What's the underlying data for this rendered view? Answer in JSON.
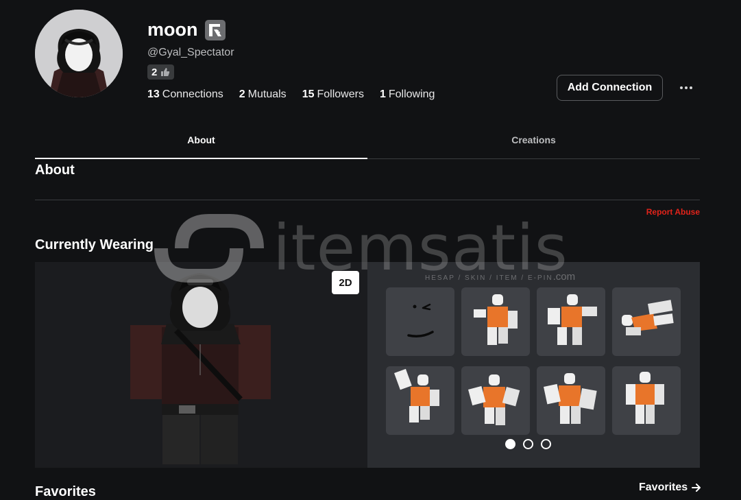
{
  "profile": {
    "display_name": "moon",
    "username": "@Gyal_Spectator",
    "badge_count": "2",
    "premium_icon": "premium-r-icon",
    "stats": [
      {
        "value": "13",
        "label": "Connections"
      },
      {
        "value": "2",
        "label": "Mutuals"
      },
      {
        "value": "15",
        "label": "Followers"
      },
      {
        "value": "1",
        "label": "Following"
      }
    ],
    "add_connection_label": "Add Connection"
  },
  "tabs": [
    {
      "label": "About",
      "active": true
    },
    {
      "label": "Creations",
      "active": false
    }
  ],
  "about": {
    "title": "About",
    "report_label": "Report Abuse"
  },
  "currently_wearing": {
    "title": "Currently Wearing",
    "toggle_label": "2D",
    "items": [
      {
        "kind": "face",
        "icon": "wink-face-icon"
      },
      {
        "kind": "animation",
        "icon": "avatar-pose-icon"
      },
      {
        "kind": "animation",
        "icon": "avatar-pose-icon"
      },
      {
        "kind": "animation",
        "icon": "avatar-pose-icon"
      },
      {
        "kind": "animation",
        "icon": "avatar-pose-icon"
      },
      {
        "kind": "animation",
        "icon": "avatar-pose-icon"
      },
      {
        "kind": "animation",
        "icon": "avatar-pose-icon"
      },
      {
        "kind": "animation",
        "icon": "avatar-pose-icon"
      }
    ],
    "page_count": 3,
    "current_page": 1
  },
  "watermark": {
    "brand": "itemsatis",
    "tagline": "HESAP / SKIN / ITEM / E-PIN",
    "suffix": ".com"
  },
  "favorites": {
    "title": "Favorites",
    "link_label": "Favorites"
  },
  "colors": {
    "background": "#111214",
    "report": "#e2231a",
    "item_tile": "#3f4146",
    "torso_orange": "#e8752a"
  }
}
